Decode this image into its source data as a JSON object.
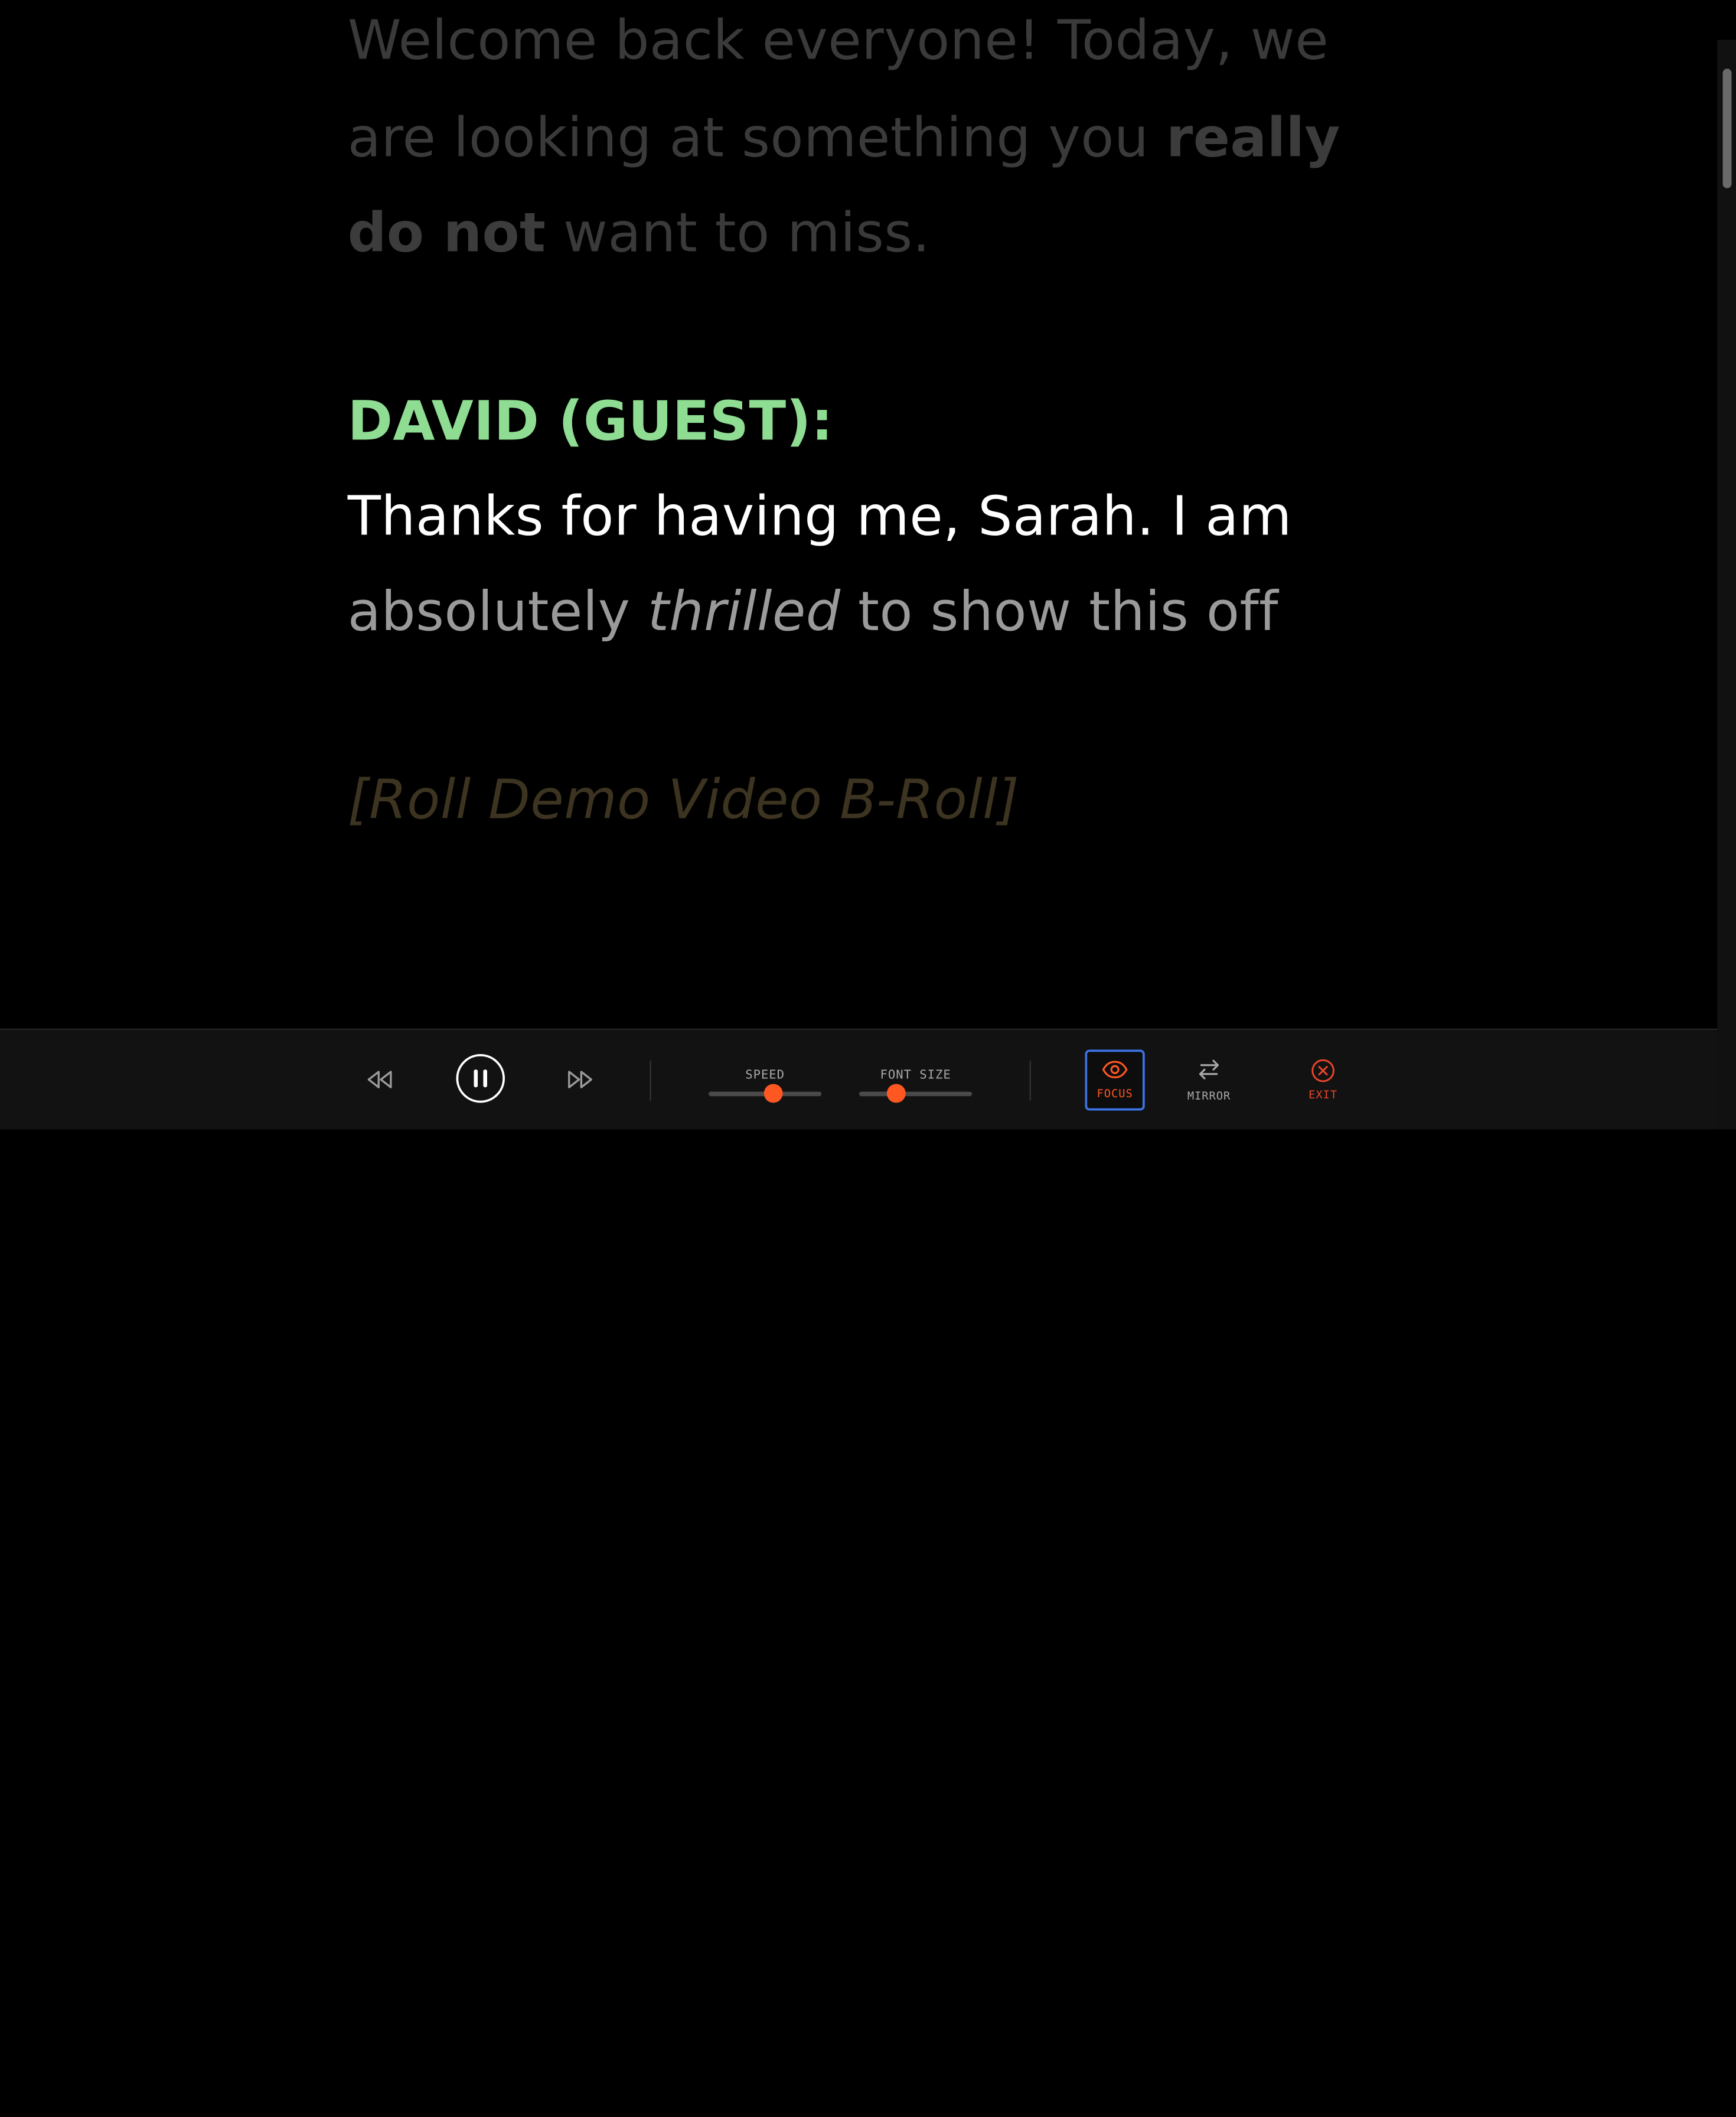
{
  "script": {
    "previous_para": {
      "line1": "Welcome back everyone! Today, we",
      "line2_pre": "are looking at something you ",
      "line2_bold": "really",
      "line3_bold": "do not",
      "line3_post": " want to miss."
    },
    "speaker": "DAVID (GUEST):",
    "current_line": "Thanks for having me, Sarah. I am",
    "next_line_pre": "absolutely ",
    "next_line_italic": "thrilled",
    "next_line_post": " to show this off",
    "cue": "[Roll Demo Video B-Roll]"
  },
  "controls": {
    "speed_label": "SPEED",
    "speed_value": 0.57,
    "font_size_label": "FONT SIZE",
    "font_size_value": 0.33,
    "focus_label": "FOCUS",
    "mirror_label": "MIRROR",
    "exit_label": "EXIT",
    "icons": {
      "rewind": "rewind-icon",
      "pause": "pause-icon",
      "forward": "fast-forward-icon",
      "focus": "eye-icon",
      "mirror": "swap-arrows-icon",
      "exit": "close-circle-icon"
    },
    "colors": {
      "accent": "#ff5722",
      "focus_border": "#3b73e8",
      "speaker": "#8fdc93"
    }
  }
}
